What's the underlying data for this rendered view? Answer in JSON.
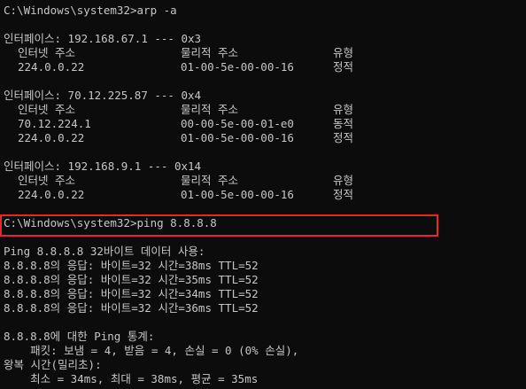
{
  "window": {
    "type": "command-prompt"
  },
  "arp": {
    "command": "C:\\Windows\\system32>arp -a",
    "interfaces": [
      {
        "header": "인터페이스: 192.168.67.1 --- 0x3",
        "columns": {
          "ip": "인터넷 주소",
          "mac": "물리적 주소",
          "type": "유형"
        },
        "rows": [
          {
            "ip": "224.0.0.22",
            "mac": "01-00-5e-00-00-16",
            "type": "정적"
          }
        ]
      },
      {
        "header": "인터페이스: 70.12.225.87 --- 0x4",
        "columns": {
          "ip": "인터넷 주소",
          "mac": "물리적 주소",
          "type": "유형"
        },
        "rows": [
          {
            "ip": "70.12.224.1",
            "mac": "00-00-5e-00-01-e0",
            "type": "동적"
          },
          {
            "ip": "224.0.0.22",
            "mac": "01-00-5e-00-00-16",
            "type": "정적"
          }
        ]
      },
      {
        "header": "인터페이스: 192.168.9.1 --- 0x14",
        "columns": {
          "ip": "인터넷 주소",
          "mac": "물리적 주소",
          "type": "유형"
        },
        "rows": [
          {
            "ip": "224.0.0.22",
            "mac": "01-00-5e-00-00-16",
            "type": "정적"
          }
        ]
      }
    ]
  },
  "ping": {
    "command": "C:\\Windows\\system32>ping 8.8.8.8",
    "intro": "Ping 8.8.8.8 32바이트 데이터 사용:",
    "replies": [
      "8.8.8.8의 응답: 바이트=32 시간=38ms TTL=52",
      "8.8.8.8의 응답: 바이트=32 시간=35ms TTL=52",
      "8.8.8.8의 응답: 바이트=32 시간=34ms TTL=52",
      "8.8.8.8의 응답: 바이트=32 시간=36ms TTL=52"
    ],
    "stats_header": "8.8.8.8에 대한 Ping 통계:",
    "packets_line": "    패킷: 보냄 = 4, 받음 = 4, 손실 = 0 (0% 손실),",
    "rtt_header": "왕복 시간(밀리초):",
    "rtt_line": "    최소 = 34ms, 최대 = 38ms, 평균 = 35ms"
  },
  "colors": {
    "background": "#0c0c0c",
    "text": "#c6c6c6",
    "highlight": "#e8262b"
  }
}
